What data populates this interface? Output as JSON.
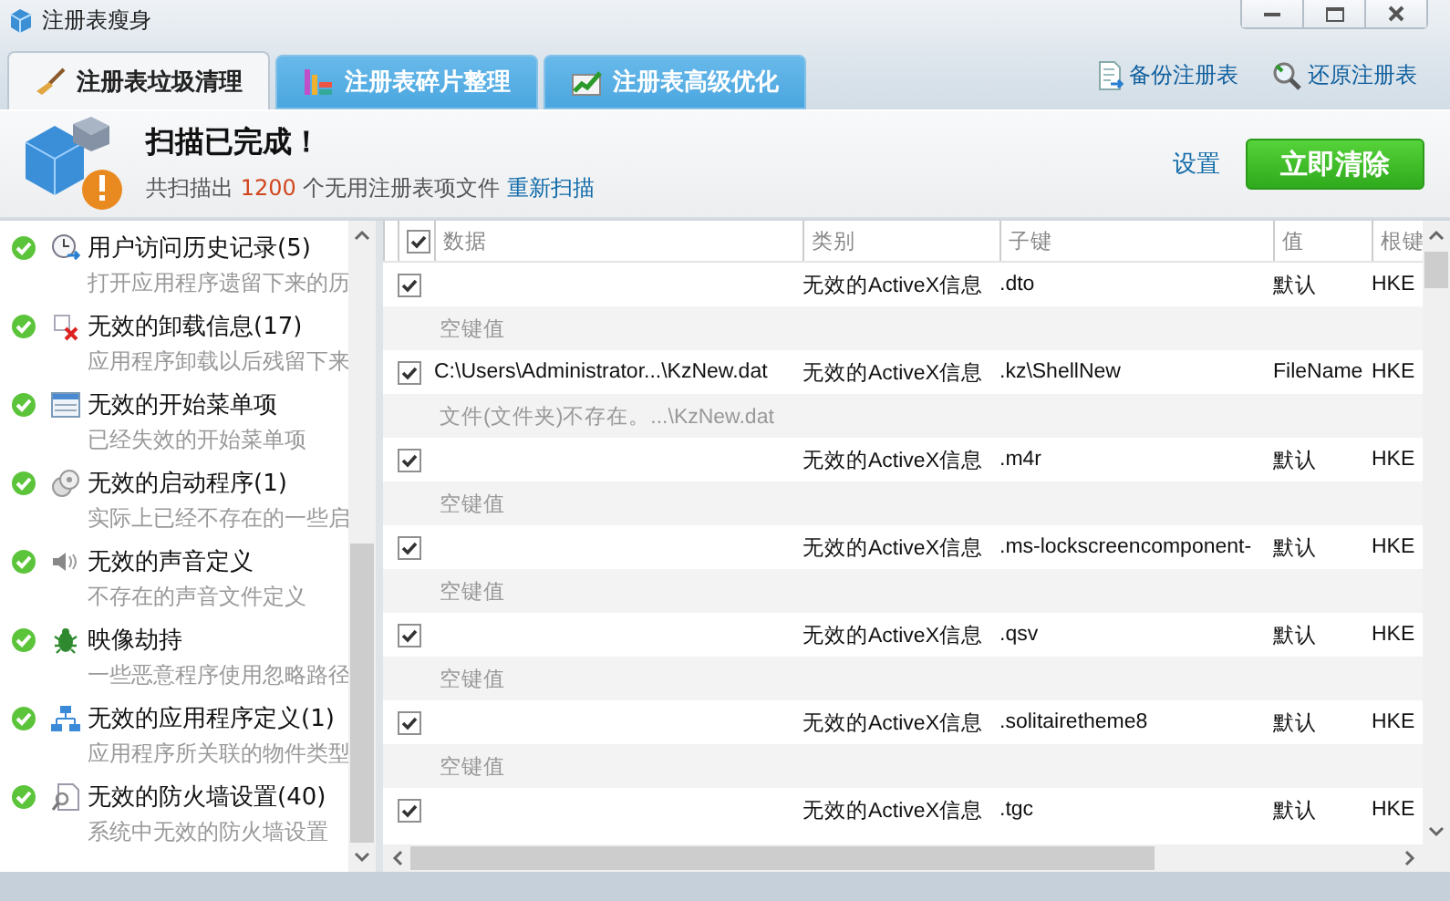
{
  "window": {
    "title": "注册表瘦身"
  },
  "tabs": [
    {
      "label": "注册表垃圾清理",
      "selected": true
    },
    {
      "label": "注册表碎片整理",
      "selected": false
    },
    {
      "label": "注册表高级优化",
      "selected": false
    }
  ],
  "toolbar_links": [
    "备份注册表",
    "还原注册表"
  ],
  "summary": {
    "title": "扫描已完成！",
    "text_before": "共扫描出",
    "count": "1200",
    "text_after": "个无用注册表项文件",
    "rescan_link": "重新扫描",
    "settings_link": "设置",
    "clean_button": "立即清除"
  },
  "sidebar": {
    "items": [
      {
        "title": "用户访问历史记录(5)",
        "description": "打开应用程序遗留下来的历",
        "checked": true
      },
      {
        "title": "无效的卸载信息(17)",
        "description": "应用程序卸载以后残留下来",
        "checked": true
      },
      {
        "title": "无效的开始菜单项",
        "description": "已经失效的开始菜单项",
        "checked": true
      },
      {
        "title": "无效的启动程序(1)",
        "description": "实际上已经不存在的一些启",
        "checked": true
      },
      {
        "title": "无效的声音定义",
        "description": "不存在的声音文件定义",
        "checked": true
      },
      {
        "title": "映像劫持",
        "description": "一些恶意程序使用忽略路径",
        "checked": true
      },
      {
        "title": "无效的应用程序定义(1)",
        "description": "应用程序所关联的物件类型",
        "checked": true
      },
      {
        "title": "无效的防火墙设置(40)",
        "description": "系统中无效的防火墙设置",
        "checked": true
      }
    ]
  },
  "table": {
    "all_checked": true,
    "columns": [
      "数据",
      "类别",
      "子键",
      "值",
      "根键"
    ],
    "rows": [
      {
        "checked": true,
        "data": "",
        "category": "无效的ActiveX信息",
        "subkey": ".dto",
        "value": "默认",
        "root": "HKE",
        "note": "空键值"
      },
      {
        "checked": true,
        "data": "C:\\Users\\Administrator...\\KzNew.dat",
        "category": "无效的ActiveX信息",
        "subkey": ".kz\\ShellNew",
        "value": "FileName",
        "root": "HKE",
        "note": "文件(文件夹)不存在。...\\KzNew.dat"
      },
      {
        "checked": true,
        "data": "",
        "category": "无效的ActiveX信息",
        "subkey": ".m4r",
        "value": "默认",
        "root": "HKE",
        "note": "空键值"
      },
      {
        "checked": true,
        "data": "",
        "category": "无效的ActiveX信息",
        "subkey": ".ms-lockscreencomponent-",
        "value": "默认",
        "root": "HKE",
        "note": "空键值"
      },
      {
        "checked": true,
        "data": "",
        "category": "无效的ActiveX信息",
        "subkey": ".qsv",
        "value": "默认",
        "root": "HKE",
        "note": "空键值"
      },
      {
        "checked": true,
        "data": "",
        "category": "无效的ActiveX信息",
        "subkey": ".solitairetheme8",
        "value": "默认",
        "root": "HKE",
        "note": "空键值"
      },
      {
        "checked": true,
        "data": "",
        "category": "无效的ActiveX信息",
        "subkey": ".tgc",
        "value": "默认",
        "root": "HKE"
      }
    ]
  }
}
